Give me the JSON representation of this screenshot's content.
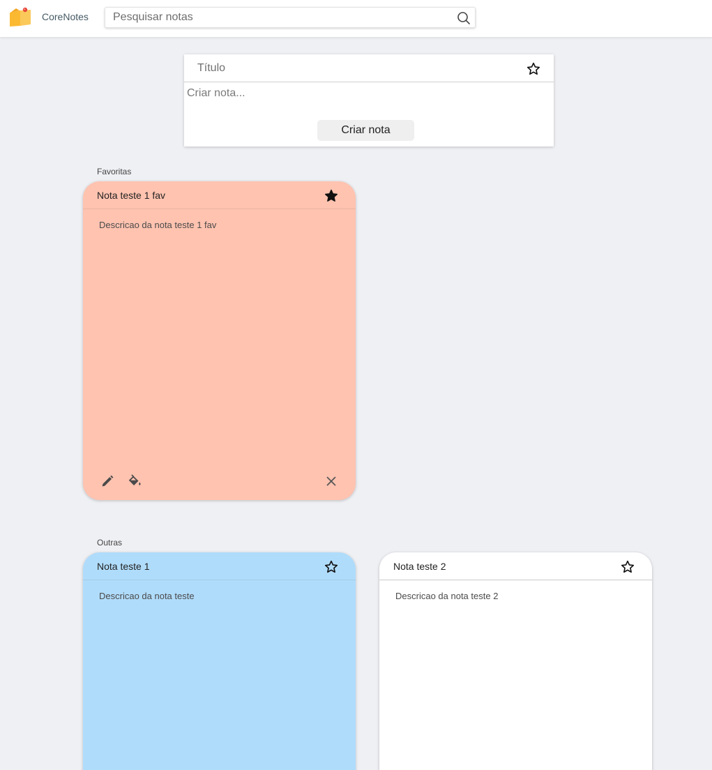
{
  "header": {
    "app_name": "CoreNotes",
    "logo_icon": "sticky-note-icon",
    "search": {
      "placeholder": "Pesquisar notas",
      "value": "",
      "icon": "search-icon"
    }
  },
  "create_form": {
    "title_placeholder": "Título",
    "body_placeholder": "Criar nota...",
    "favorite_icon": "star-outline-icon",
    "submit_label": "Criar nota"
  },
  "sections": {
    "favorites": {
      "label": "Favoritas",
      "notes": [
        {
          "title": "Nota teste 1 fav",
          "description": "Descricao da nota teste 1 fav",
          "color": "#ffc3b0",
          "favorite": true,
          "actions": [
            "pencil-icon",
            "paint-bucket-icon",
            "close-icon"
          ]
        }
      ]
    },
    "others": {
      "label": "Outras",
      "notes": [
        {
          "title": "Nota teste 1",
          "description": "Descricao da nota teste",
          "color": "#b0dcfb",
          "favorite": false
        },
        {
          "title": "Nota teste 2",
          "description": "Descricao da nota teste 2",
          "color": "#ffffff",
          "favorite": false
        }
      ]
    }
  },
  "colors": {
    "background": "#eff0f4",
    "header": "#ffffff",
    "note_salmon": "#ffc3b0",
    "note_blue": "#b0dcfb",
    "note_white": "#ffffff"
  }
}
